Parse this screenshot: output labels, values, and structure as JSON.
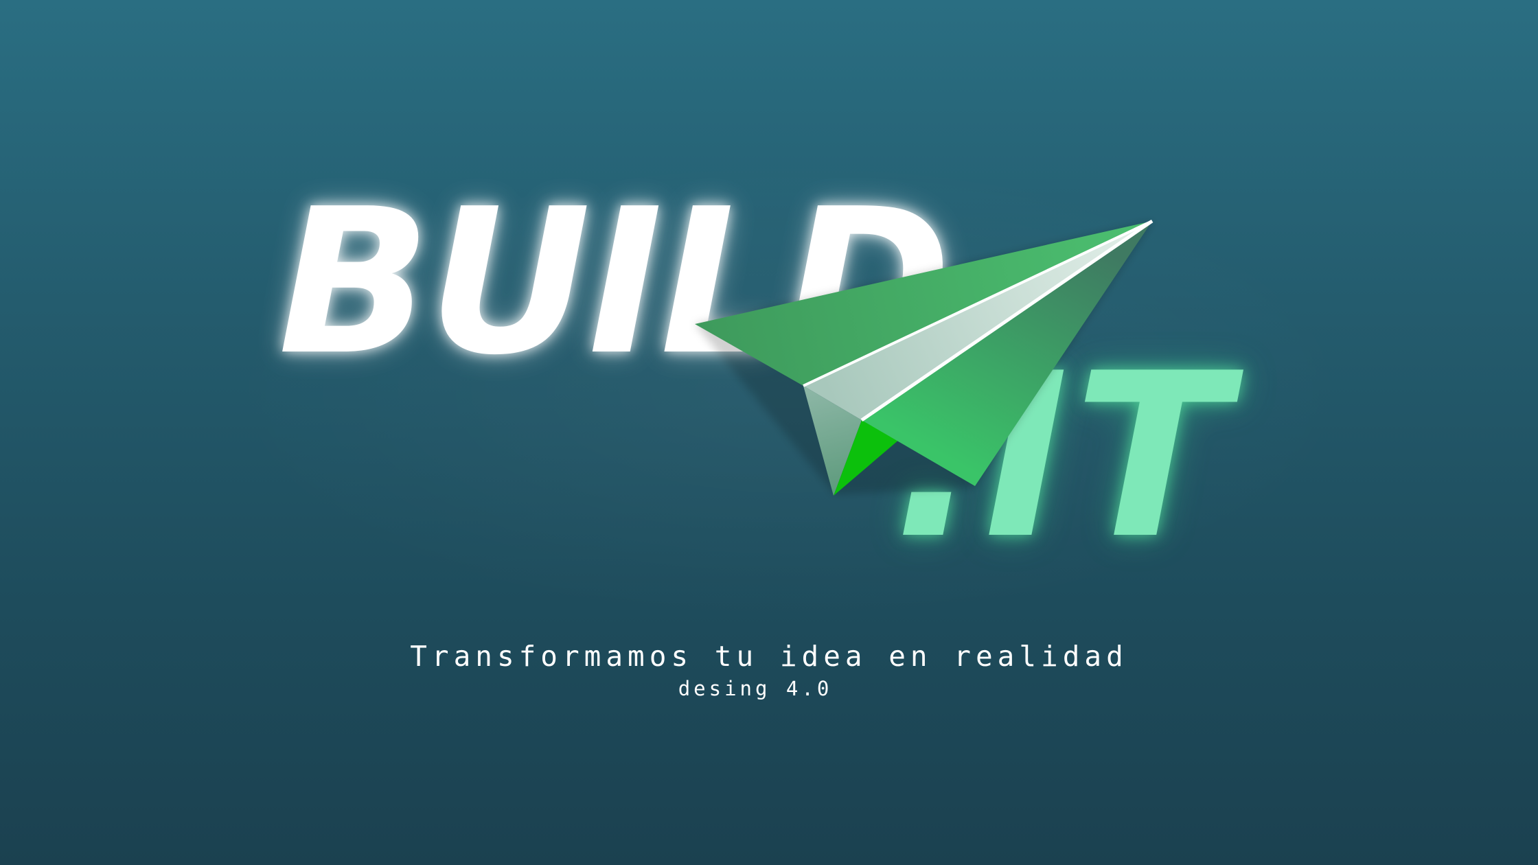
{
  "brand": {
    "name_main": "BUILD",
    "name_suffix": ".IT",
    "logo_icon": "paper-plane-icon",
    "colors": {
      "background_top": "#2a6e82",
      "background_bottom": "#1b4150",
      "main_text": "#ffffff",
      "suffix_text": "#7ee8b8",
      "plane_green": "#46b366",
      "plane_bright_green": "#0cc00c"
    }
  },
  "tagline": "Transformamos tu idea en realidad",
  "version": "desing 4.0"
}
